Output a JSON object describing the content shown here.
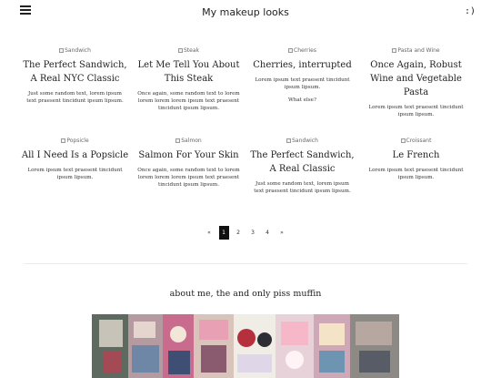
{
  "header": {
    "title": "My makeup looks",
    "right_text": ":)"
  },
  "posts": [
    {
      "img_alt": "Sandwich",
      "title": "The Perfect Sandwich, A Real NYC Classic",
      "excerpt": "Just some random text, lorem ipsum text praesent tincidunt ipsum lipsum.",
      "extra": ""
    },
    {
      "img_alt": "Steak",
      "title": "Let Me Tell You About This Steak",
      "excerpt": "Once again, some random text to lorem lorem lorem lorem ipsum text praesent tincidunt ipsum lipsum.",
      "extra": ""
    },
    {
      "img_alt": "Cherries",
      "title": "Cherries, interrupted",
      "excerpt": "Lorem ipsum text praesent tincidunt ipsum lipsum.",
      "extra": "What else?"
    },
    {
      "img_alt": "Pasta and Wine",
      "title": "Once Again, Robust Wine and Vegetable Pasta",
      "excerpt": "Lorem ipsum text praesent tincidunt ipsum lipsum.",
      "extra": ""
    },
    {
      "img_alt": "Popsicle",
      "title": "All I Need Is a Popsicle",
      "excerpt": "Lorem ipsum text praesent tincidunt ipsum lipsum.",
      "extra": ""
    },
    {
      "img_alt": "Salmon",
      "title": "Salmon For Your Skin",
      "excerpt": "Once again, some random text to lorem lorem lorem lorem ipsum text praesent tincidunt ipsum lipsum.",
      "extra": ""
    },
    {
      "img_alt": "Sandwich",
      "title": "The Perfect Sandwich, A Real Classic",
      "excerpt": "Just some random text, lorem ipsum text praesent tincidunt ipsum lipsum.",
      "extra": ""
    },
    {
      "img_alt": "Croissant",
      "title": "Le French",
      "excerpt": "Lorem ipsum text praesent tincidunt ipsum lipsum.",
      "extra": ""
    }
  ],
  "pagination": {
    "prev": "«",
    "pages": [
      "1",
      "2",
      "3",
      "4"
    ],
    "active_page": "1",
    "next": "»"
  },
  "about": {
    "heading": "about me, the and only piss muffin"
  }
}
